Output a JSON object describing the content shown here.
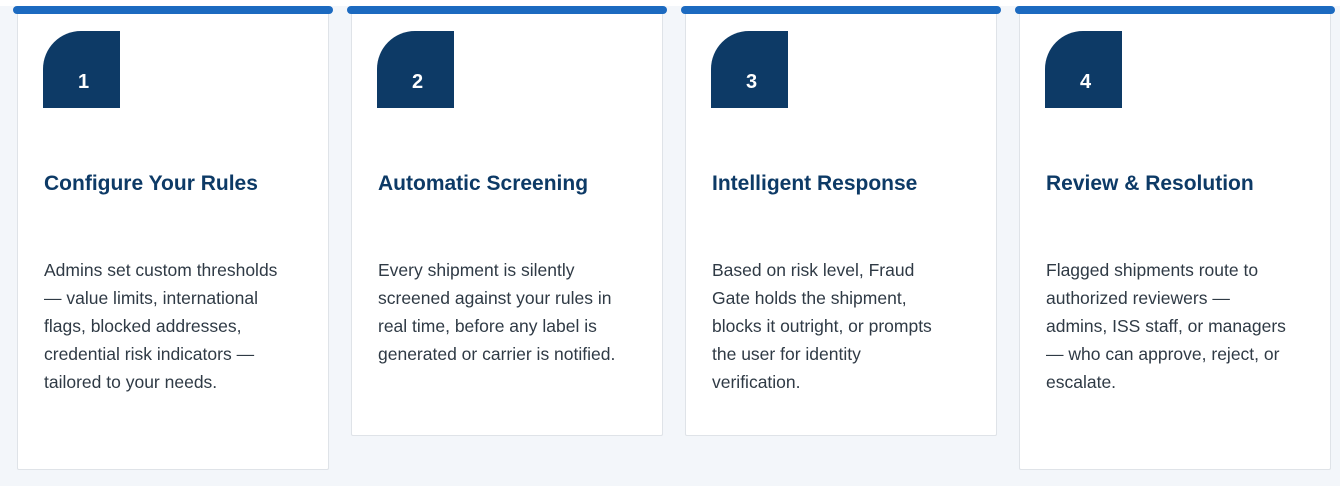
{
  "steps": [
    {
      "number": "1",
      "title": "Configure Your Rules",
      "description": "Admins set custom thresholds — value limits, international flags, blocked addresses, credential risk indicators — tailored to your needs."
    },
    {
      "number": "2",
      "title": "Automatic Screening",
      "description": "Every shipment is silently screened against your rules in real time, before any label is generated or carrier is notified."
    },
    {
      "number": "3",
      "title": "Intelligent Response",
      "description": "Based on risk level, Fraud Gate holds the shipment, blocks it outright, or prompts the user for identity verification."
    },
    {
      "number": "4",
      "title": "Review & Resolution",
      "description": "Flagged shipments route to authorized reviewers — admins, ISS staff, or managers — who can approve, reject, or escalate."
    }
  ],
  "colors": {
    "accent_bar": "#1c6ac0",
    "badge": "#0d3a66",
    "title": "#0d3a66",
    "text": "#2f3a45",
    "background": "#f3f6fa"
  }
}
